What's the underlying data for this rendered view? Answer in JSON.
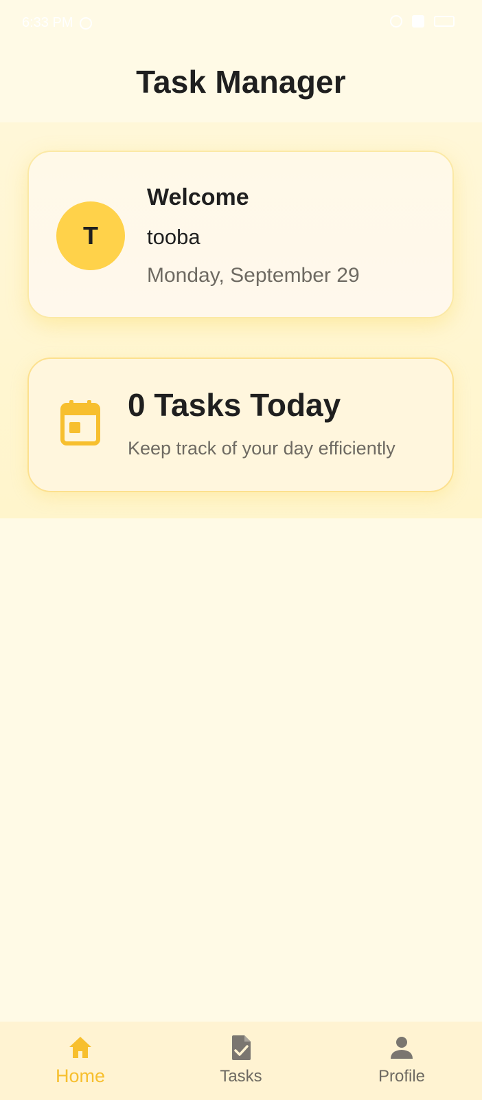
{
  "status_bar": {
    "time": "6:33 PM",
    "icons": [
      "alarm-icon",
      "wifi-icon",
      "signal-icon",
      "battery-icon"
    ]
  },
  "header": {
    "title": "Task Manager"
  },
  "welcome_card": {
    "avatar_initial": "T",
    "title": "Welcome",
    "name": "tooba",
    "date": "Monday, September 29"
  },
  "tasks_card": {
    "icon": "calendar-icon",
    "count_label": "0 Tasks Today",
    "subtitle": "Keep track of your day efficiently"
  },
  "bottom_nav": {
    "items": [
      {
        "label": "Home",
        "icon": "home-icon",
        "active": true
      },
      {
        "label": "Tasks",
        "icon": "task-document-icon",
        "active": false
      },
      {
        "label": "Profile",
        "icon": "person-icon",
        "active": false
      }
    ]
  },
  "colors": {
    "accent": "#F7BF2E",
    "avatar": "#FFD24A",
    "background": "#FFFAE6",
    "text_primary": "#1F1F1F",
    "text_secondary": "#6E6A62"
  }
}
